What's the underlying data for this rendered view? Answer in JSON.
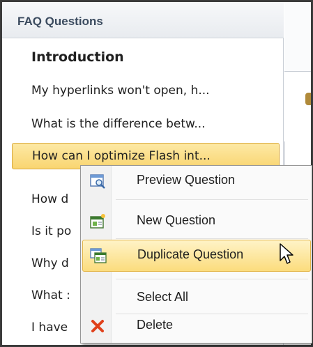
{
  "panel": {
    "title": "FAQ Questions"
  },
  "list": {
    "items": [
      {
        "text": "Introduction",
        "type": "heading"
      },
      {
        "text": "My hyperlinks won't open, h...",
        "type": "item"
      },
      {
        "text": "What is the difference betw...",
        "type": "item"
      },
      {
        "text": "How can I optimize Flash int...",
        "type": "selected"
      },
      {
        "text": "How d",
        "type": "item"
      },
      {
        "text": "Is it po",
        "type": "item"
      },
      {
        "text": "Why d",
        "type": "item"
      },
      {
        "text": "What :",
        "type": "item"
      },
      {
        "text": "I have",
        "type": "item"
      }
    ]
  },
  "context_menu": {
    "items": [
      {
        "label": "Preview Question",
        "icon": "preview-question-icon"
      },
      {
        "label": "New Question",
        "icon": "new-question-icon"
      },
      {
        "label": "Duplicate Question",
        "icon": "duplicate-question-icon"
      },
      {
        "label": "Select All",
        "icon": ""
      },
      {
        "label": "Delete",
        "icon": "delete-x-icon"
      }
    ],
    "highlighted_index": 2
  },
  "colors": {
    "selection_fill": "#f9d571",
    "header_text": "#3a4a5e",
    "delete_icon": "#e0401a"
  }
}
